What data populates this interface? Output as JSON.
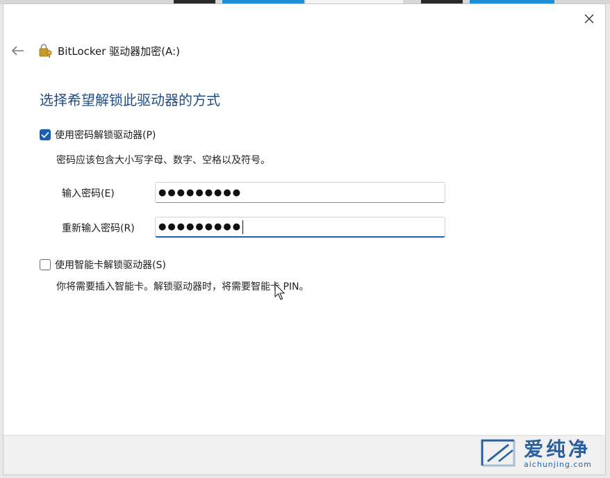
{
  "window": {
    "title": "BitLocker 驱动器加密(A:)",
    "close_icon": "close-icon",
    "back_icon": "back-arrow-icon",
    "app_icon": "bitlocker-lock-icon"
  },
  "content": {
    "heading": "选择希望解锁此驱动器的方式",
    "password_option": {
      "label": "使用密码解锁驱动器(P)",
      "checked": true,
      "description": "密码应该包含大小写字母、数字、空格以及符号。"
    },
    "fields": {
      "enter_password_label": "输入密码(E)",
      "enter_password_value": "●●●●●●●●●",
      "reenter_password_label": "重新输入密码(R)",
      "reenter_password_value": "●●●●●●●●●"
    },
    "smartcard_option": {
      "label": "使用智能卡解锁驱动器(S)",
      "checked": false,
      "description": "你将需要插入智能卡。解锁驱动器时，将需要智能卡 PIN。"
    }
  },
  "watermark": {
    "title": "爱纯净",
    "url": "aichunjing.com"
  },
  "colors": {
    "accent": "#1a5fb4",
    "heading": "#1f4e8a",
    "footer": "#f0f0f0",
    "watermark": "#2b5f9e"
  }
}
